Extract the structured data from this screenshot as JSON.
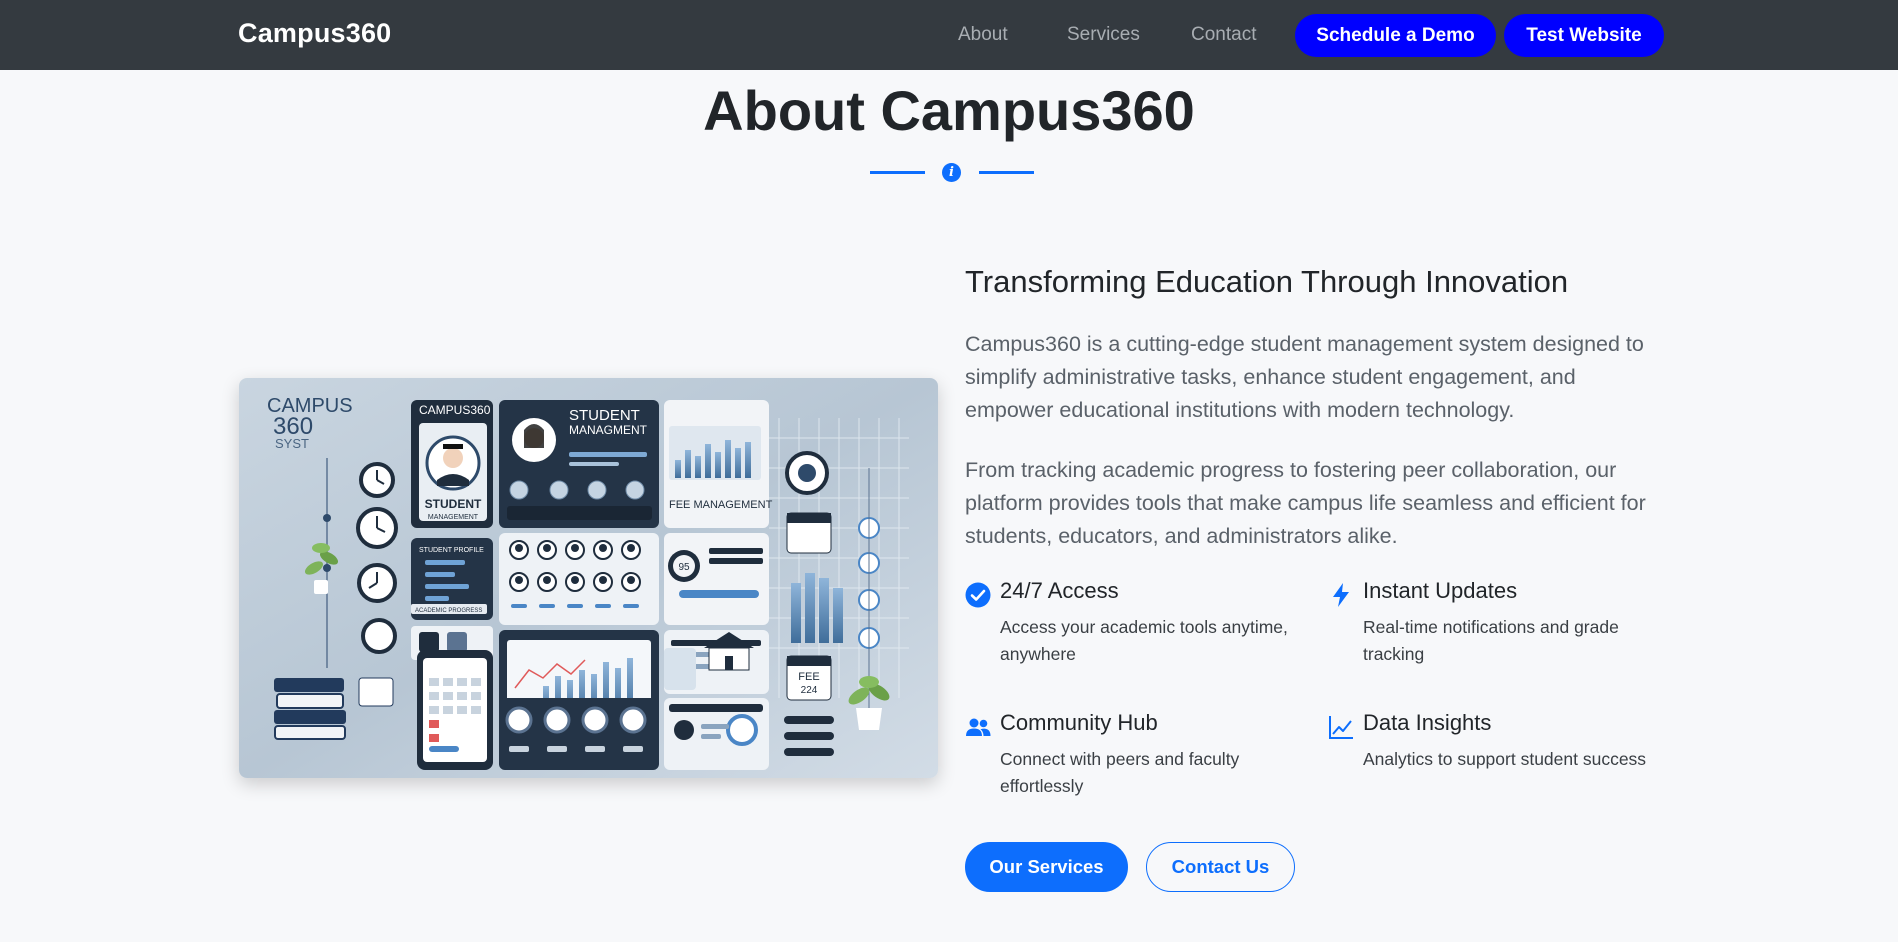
{
  "navbar": {
    "brand": "Campus360",
    "links": [
      "About",
      "Services",
      "Contact"
    ],
    "demo_button": "Schedule a Demo",
    "test_button": "Test Website"
  },
  "section": {
    "title": "About Campus360",
    "divider_icon": "info-icon"
  },
  "hero_image": {
    "label_brand": "CAMPUS360",
    "label_top_left": "CAMPUS",
    "label_360": "360",
    "label_syst": "SYST",
    "label_student": "STUDENT",
    "label_management": "MANAGEMENT",
    "label_student_mgmt": "STUDENT",
    "label_mgmt_line2": "MANAGMENT",
    "label_fee": "FEE MANAGEMENT",
    "label_student_profile": "STUDENT PROFILE",
    "label_academic": "ACADEMIC PROGRESS",
    "label_fee_card": "FEE",
    "label_fee_num": "224",
    "label_gauge": "95"
  },
  "about": {
    "heading": "Transforming Education Through Innovation",
    "paragraph_1": "Campus360 is a cutting-edge student management system designed to simplify administrative tasks, enhance student engagement, and empower educational institutions with modern technology.",
    "paragraph_2": "From tracking academic progress to fostering peer collaboration, our platform provides tools that make campus life seamless and efficient for students, educators, and administrators alike.",
    "features": [
      {
        "title": "24/7 Access",
        "description": "Access your academic tools anytime, anywhere",
        "icon": "check-circle-icon"
      },
      {
        "title": "Instant Updates",
        "description": "Real-time notifications and grade tracking",
        "icon": "lightning-icon"
      },
      {
        "title": "Community Hub",
        "description": "Connect with peers and faculty effortlessly",
        "icon": "people-icon"
      },
      {
        "title": "Data Insights",
        "description": "Analytics to support student success",
        "icon": "line-chart-icon"
      }
    ],
    "services_button": "Our Services",
    "contact_button": "Contact Us"
  },
  "colors": {
    "navbar_bg": "#343a40",
    "nav_button": "#0000ff",
    "accent": "#0d6efd",
    "page_bg": "#f7f8fa"
  }
}
